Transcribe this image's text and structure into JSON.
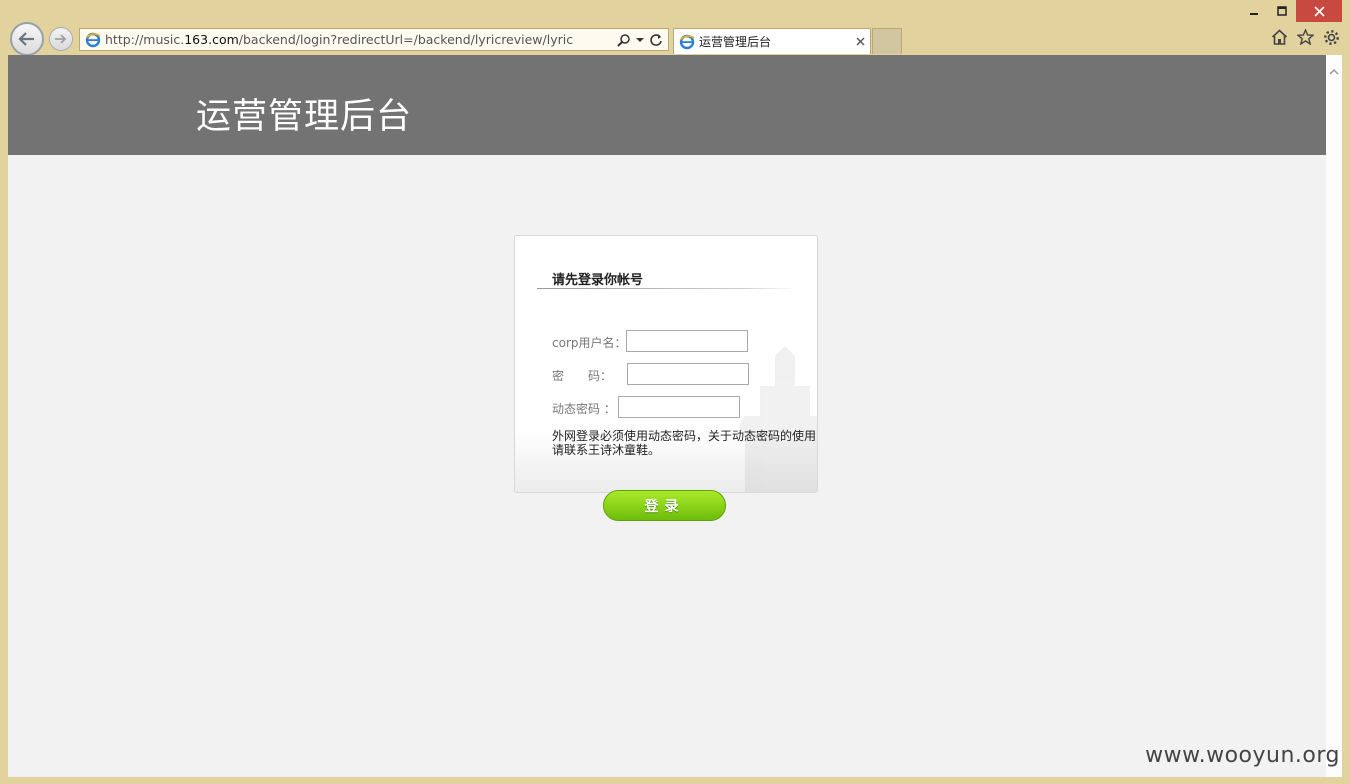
{
  "browser": {
    "address_prefix": "http://music.",
    "address_domain": "163.com",
    "address_suffix": "/backend/login?redirectUrl=/backend/lyricreview/lyric",
    "tab_title": "运营管理后台"
  },
  "page": {
    "site_title": "运营管理后台"
  },
  "login": {
    "heading": "请先登录你帐号",
    "username_label": "corp用户名：",
    "password_label": "密　　码：",
    "otp_label": "动态密码 ：",
    "note": "外网登录必须使用动态密码，关于动态密码的使用请联系王诗沐童鞋。",
    "submit_label": "登录",
    "username_value": "",
    "password_value": "",
    "otp_value": ""
  },
  "watermark_text": "www.wooyun.org",
  "colors": {
    "header_bg": "#737373",
    "page_bg": "#f2f2f2",
    "frame": "#e1d29e",
    "button_green": "#7fd113",
    "close_red": "#c7493f"
  }
}
